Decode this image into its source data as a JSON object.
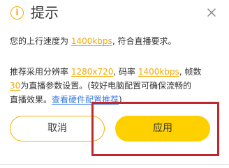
{
  "dialog": {
    "title": "提示",
    "info_icon": "info-icon",
    "close_icon": "close-icon",
    "colors": {
      "accent": "#f2a900",
      "apply_button": "#ffd000",
      "link": "#3a7be0",
      "highlight_box": "#c0282d"
    }
  },
  "message": {
    "line1_prefix": "您的上行速度为 ",
    "upload_speed": "1400kbps",
    "line1_suffix": ", 符合直播要求。",
    "rec_prefix": "推荐采用分辨率 ",
    "resolution": "1280x720",
    "rec_bitrate_label": ", 码率 ",
    "bitrate": "1400kbps",
    "rec_fps_label": ", 帧数",
    "fps": "30",
    "rec_suffix": "为直播参数设置。(较好电脑配置可确保流畅的",
    "rec_line3": "直播效果。",
    "hardware_link": "查看硬件配置推荐",
    "rec_end": ")"
  },
  "buttons": {
    "cancel": "取消",
    "apply": "应用"
  }
}
